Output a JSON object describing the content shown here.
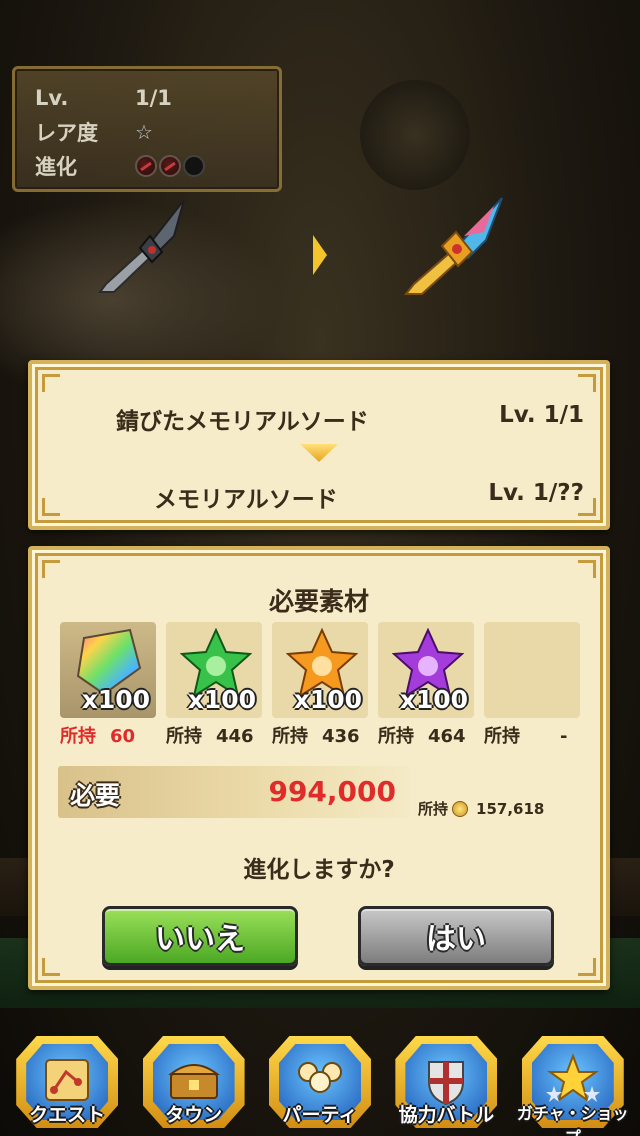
{
  "status": {
    "level_label": "Lv.",
    "level_value": "1/1",
    "rarity_label": "レア度",
    "rarity_icon": "star-icon",
    "evolution_label": "進化",
    "evolution_dots": [
      "filled",
      "filled",
      "empty"
    ]
  },
  "evolution": {
    "from_name": "錆びたメモリアルソード",
    "from_level": "Lv.  1/1",
    "to_name": "メモリアルソード",
    "to_level": "Lv.  1/??"
  },
  "materials": {
    "title": "必要素材",
    "items": [
      {
        "icon": "rainbow-crystal-icon",
        "quantity": "x100",
        "owned_label": "所持",
        "owned": "60",
        "insufficient": true
      },
      {
        "icon": "green-star-gem-icon",
        "quantity": "x100",
        "owned_label": "所持",
        "owned": "446",
        "insufficient": false
      },
      {
        "icon": "orange-star-gem-icon",
        "quantity": "x100",
        "owned_label": "所持",
        "owned": "436",
        "insufficient": false
      },
      {
        "icon": "purple-star-gem-icon",
        "quantity": "x100",
        "owned_label": "所持",
        "owned": "464",
        "insufficient": false
      },
      {
        "icon": "",
        "quantity": "",
        "owned_label": "所持",
        "owned": "-",
        "insufficient": false
      }
    ]
  },
  "cost": {
    "label": "必要",
    "value": "994,000",
    "owned_label": "所持",
    "owned_value": "157,618"
  },
  "dialog": {
    "question": "進化しますか?",
    "no_label": "いいえ",
    "yes_label": "はい"
  },
  "nav": {
    "items": [
      {
        "label": "クエスト",
        "icon": "quest-map-icon"
      },
      {
        "label": "タウン",
        "icon": "town-treasure-icon"
      },
      {
        "label": "パーティ",
        "icon": "party-icon"
      },
      {
        "label": "協力バトル",
        "icon": "coop-battle-shield-icon"
      },
      {
        "label": "ガチャ・ショップ",
        "icon": "gacha-star-icon"
      }
    ]
  },
  "colors": {
    "insufficient": "#e02b2b",
    "accent_gold": "#f3c42c",
    "no_button": "#4ca824",
    "yes_button": "#7d7d7d"
  }
}
